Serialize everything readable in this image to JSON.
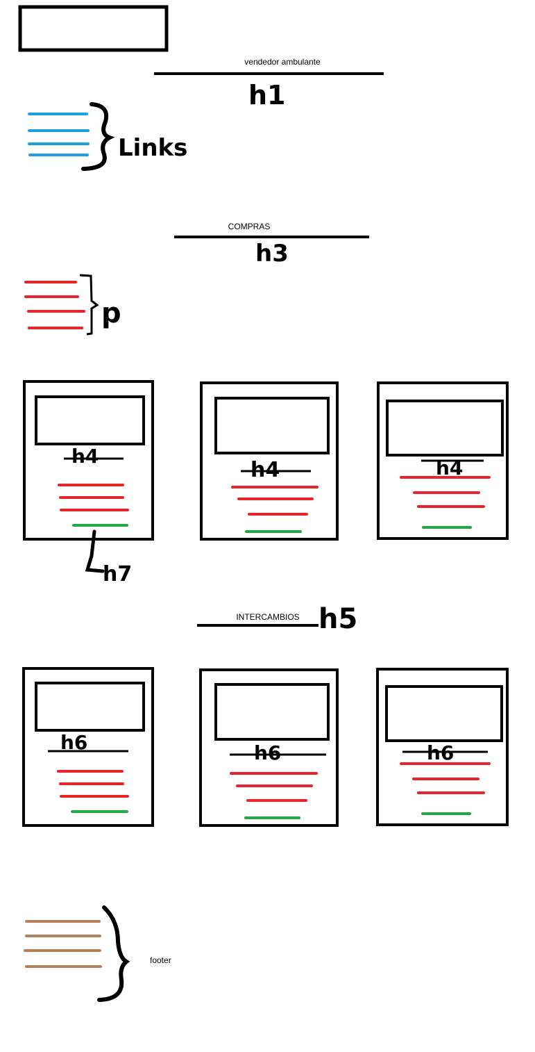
{
  "labels": {
    "title": "vendedor ambulante",
    "compras": "COMPRAS",
    "intercambios": "INTERCAMBIOS",
    "footer": "footer"
  },
  "handwritten": {
    "h1": "h1",
    "links": "Links",
    "h3": "h3",
    "p": "p",
    "h4": "h4",
    "h7": "h7",
    "h5": "h5",
    "h6": "h6"
  },
  "colors": {
    "outline": "#000000",
    "links": "#1ba1e2",
    "paragraph": "#e8242b",
    "price": "#22a845",
    "footer": "#b5805a"
  }
}
